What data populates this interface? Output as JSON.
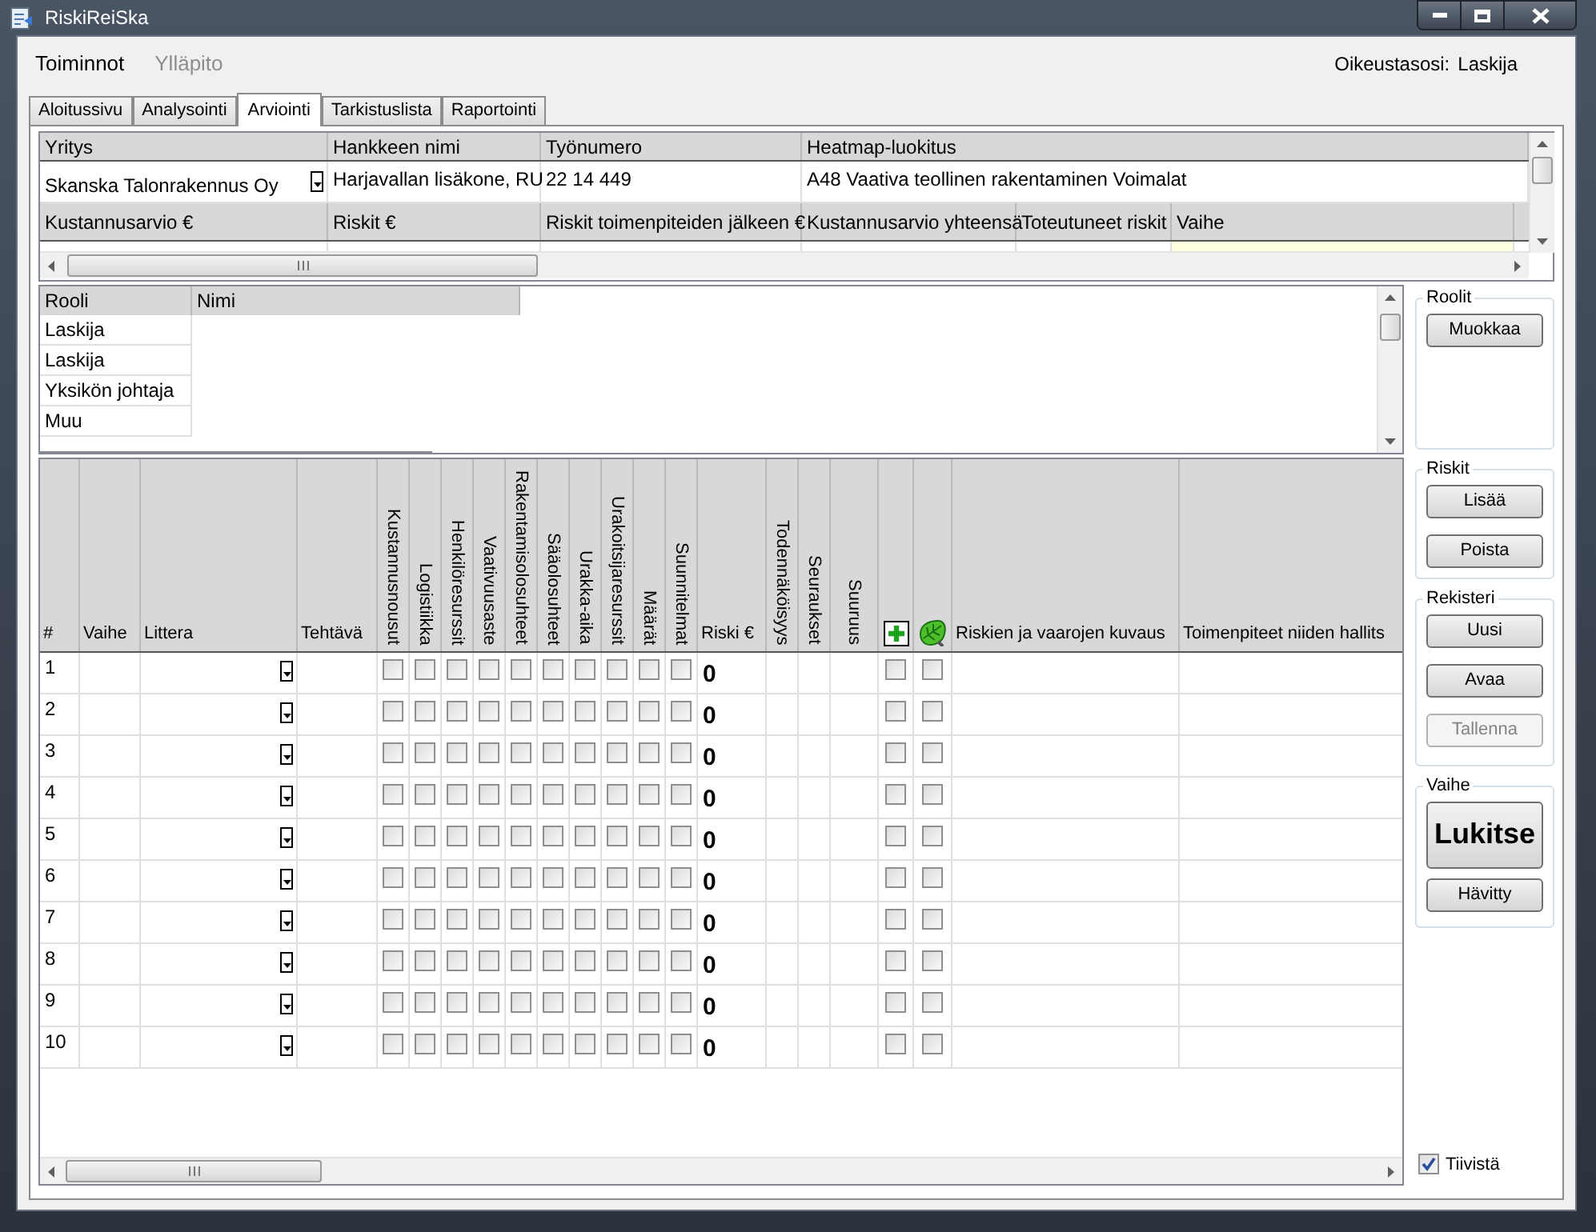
{
  "window": {
    "title": "RiskiReiSka"
  },
  "menu": [
    {
      "label": "Toiminnot",
      "disabled": false
    },
    {
      "label": "Ylläpito",
      "disabled": true
    }
  ],
  "access": {
    "label": "Oikeustasosi:",
    "value": "Laskija"
  },
  "tabs": [
    {
      "label": "Aloitussivu",
      "selected": false
    },
    {
      "label": "Analysointi",
      "selected": false
    },
    {
      "label": "Arviointi",
      "selected": true
    },
    {
      "label": "Tarkistuslista",
      "selected": false
    },
    {
      "label": "Raportointi",
      "selected": false
    }
  ],
  "project": {
    "header_1": [
      "Yritys",
      "Hankkeen nimi",
      "Työnumero",
      "Heatmap-luokitus"
    ],
    "values_1": [
      "Skanska Talonrakennus Oy",
      "Harjavallan lisäkone, RU",
      "22 14 449",
      "A48 Vaativa teollinen rakentaminen Voimalat"
    ],
    "header_2": [
      "Kustannusarvio €",
      "Riskit €",
      "Riskit toimenpiteiden jälkeen €",
      "Kustannusarvio yhteensä",
      "Toteutuneet riskit",
      "Vaihe"
    ]
  },
  "roles": {
    "columns": [
      "Rooli",
      "Nimi"
    ],
    "rows": [
      {
        "role": "Laskija"
      },
      {
        "role": "Laskija"
      },
      {
        "role": "Yksikön johtaja"
      },
      {
        "role": "Muu"
      }
    ]
  },
  "risks": {
    "columns": [
      {
        "label": "#",
        "kind": "plain"
      },
      {
        "label": "Vaihe",
        "kind": "plain"
      },
      {
        "label": "Littera",
        "kind": "plain"
      },
      {
        "label": "Tehtävä",
        "kind": "plain"
      },
      {
        "label": "Kustannusnousut",
        "kind": "vertical"
      },
      {
        "label": "Logistiikka",
        "kind": "vertical"
      },
      {
        "label": "Henkilöresurssit",
        "kind": "vertical"
      },
      {
        "label": "Vaativuusaste",
        "kind": "vertical"
      },
      {
        "label": "Rakentamisolosuhteet",
        "kind": "vertical"
      },
      {
        "label": "Sääolosuhteet",
        "kind": "vertical"
      },
      {
        "label": "Urakka-aika",
        "kind": "vertical"
      },
      {
        "label": "Urakoitsijaresurssit",
        "kind": "vertical"
      },
      {
        "label": "Määrät",
        "kind": "vertical"
      },
      {
        "label": "Suunnitelmat",
        "kind": "vertical"
      },
      {
        "label": "Riski €",
        "kind": "plain"
      },
      {
        "label": "Todennäköisyys",
        "kind": "vertical"
      },
      {
        "label": "Seuraukset",
        "kind": "vertical"
      },
      {
        "label": "Suuruus",
        "kind": "vertical"
      },
      {
        "kind": "add-icon"
      },
      {
        "kind": "leaf-icon"
      },
      {
        "label": "Riskien ja vaarojen kuvaus",
        "kind": "plain"
      },
      {
        "label": "Toimenpiteet niiden hallits",
        "kind": "plain"
      }
    ],
    "rows": [
      {
        "number": "1",
        "risk": "0",
        "flags": [
          false,
          false,
          false,
          false,
          false,
          false,
          false,
          false,
          false,
          false
        ],
        "marks": [
          false,
          false
        ]
      },
      {
        "number": "2",
        "risk": "0",
        "flags": [
          false,
          false,
          false,
          false,
          false,
          false,
          false,
          false,
          false,
          false
        ],
        "marks": [
          false,
          false
        ]
      },
      {
        "number": "3",
        "risk": "0",
        "flags": [
          false,
          false,
          false,
          false,
          false,
          false,
          false,
          false,
          false,
          false
        ],
        "marks": [
          false,
          false
        ]
      },
      {
        "number": "4",
        "risk": "0",
        "flags": [
          false,
          false,
          false,
          false,
          false,
          false,
          false,
          false,
          false,
          false
        ],
        "marks": [
          false,
          false
        ]
      },
      {
        "number": "5",
        "risk": "0",
        "flags": [
          false,
          false,
          false,
          false,
          false,
          false,
          false,
          false,
          false,
          false
        ],
        "marks": [
          false,
          false
        ]
      },
      {
        "number": "6",
        "risk": "0",
        "flags": [
          false,
          false,
          false,
          false,
          false,
          false,
          false,
          false,
          false,
          false
        ],
        "marks": [
          false,
          false
        ]
      },
      {
        "number": "7",
        "risk": "0",
        "flags": [
          false,
          false,
          false,
          false,
          false,
          false,
          false,
          false,
          false,
          false
        ],
        "marks": [
          false,
          false
        ]
      },
      {
        "number": "8",
        "risk": "0",
        "flags": [
          false,
          false,
          false,
          false,
          false,
          false,
          false,
          false,
          false,
          false
        ],
        "marks": [
          false,
          false
        ]
      },
      {
        "number": "9",
        "risk": "0",
        "flags": [
          false,
          false,
          false,
          false,
          false,
          false,
          false,
          false,
          false,
          false
        ],
        "marks": [
          false,
          false
        ]
      },
      {
        "number": "10",
        "risk": "0",
        "flags": [
          false,
          false,
          false,
          false,
          false,
          false,
          false,
          false,
          false,
          false
        ],
        "marks": [
          false,
          false
        ]
      }
    ]
  },
  "side_groups": [
    {
      "title": "Roolit",
      "buttons": [
        {
          "label": "Muokkaa",
          "kind": "normal",
          "disabled": false
        }
      ]
    },
    {
      "title": "Riskit",
      "buttons": [
        {
          "label": "Lisää",
          "kind": "normal",
          "disabled": false
        },
        {
          "label": "Poista",
          "kind": "normal",
          "disabled": false
        }
      ]
    },
    {
      "title": "Rekisteri",
      "buttons": [
        {
          "label": "Uusi",
          "kind": "normal",
          "disabled": false
        },
        {
          "label": "Avaa",
          "kind": "normal",
          "disabled": false
        },
        {
          "label": "Tallenna",
          "kind": "normal",
          "disabled": true
        }
      ]
    },
    {
      "title": "Vaihe",
      "buttons": [
        {
          "label": "Lukitse",
          "kind": "large",
          "disabled": false
        },
        {
          "label": "Hävitty",
          "kind": "normal",
          "disabled": false
        }
      ]
    }
  ],
  "compact": {
    "label": "Tiivistä",
    "checked": true
  }
}
